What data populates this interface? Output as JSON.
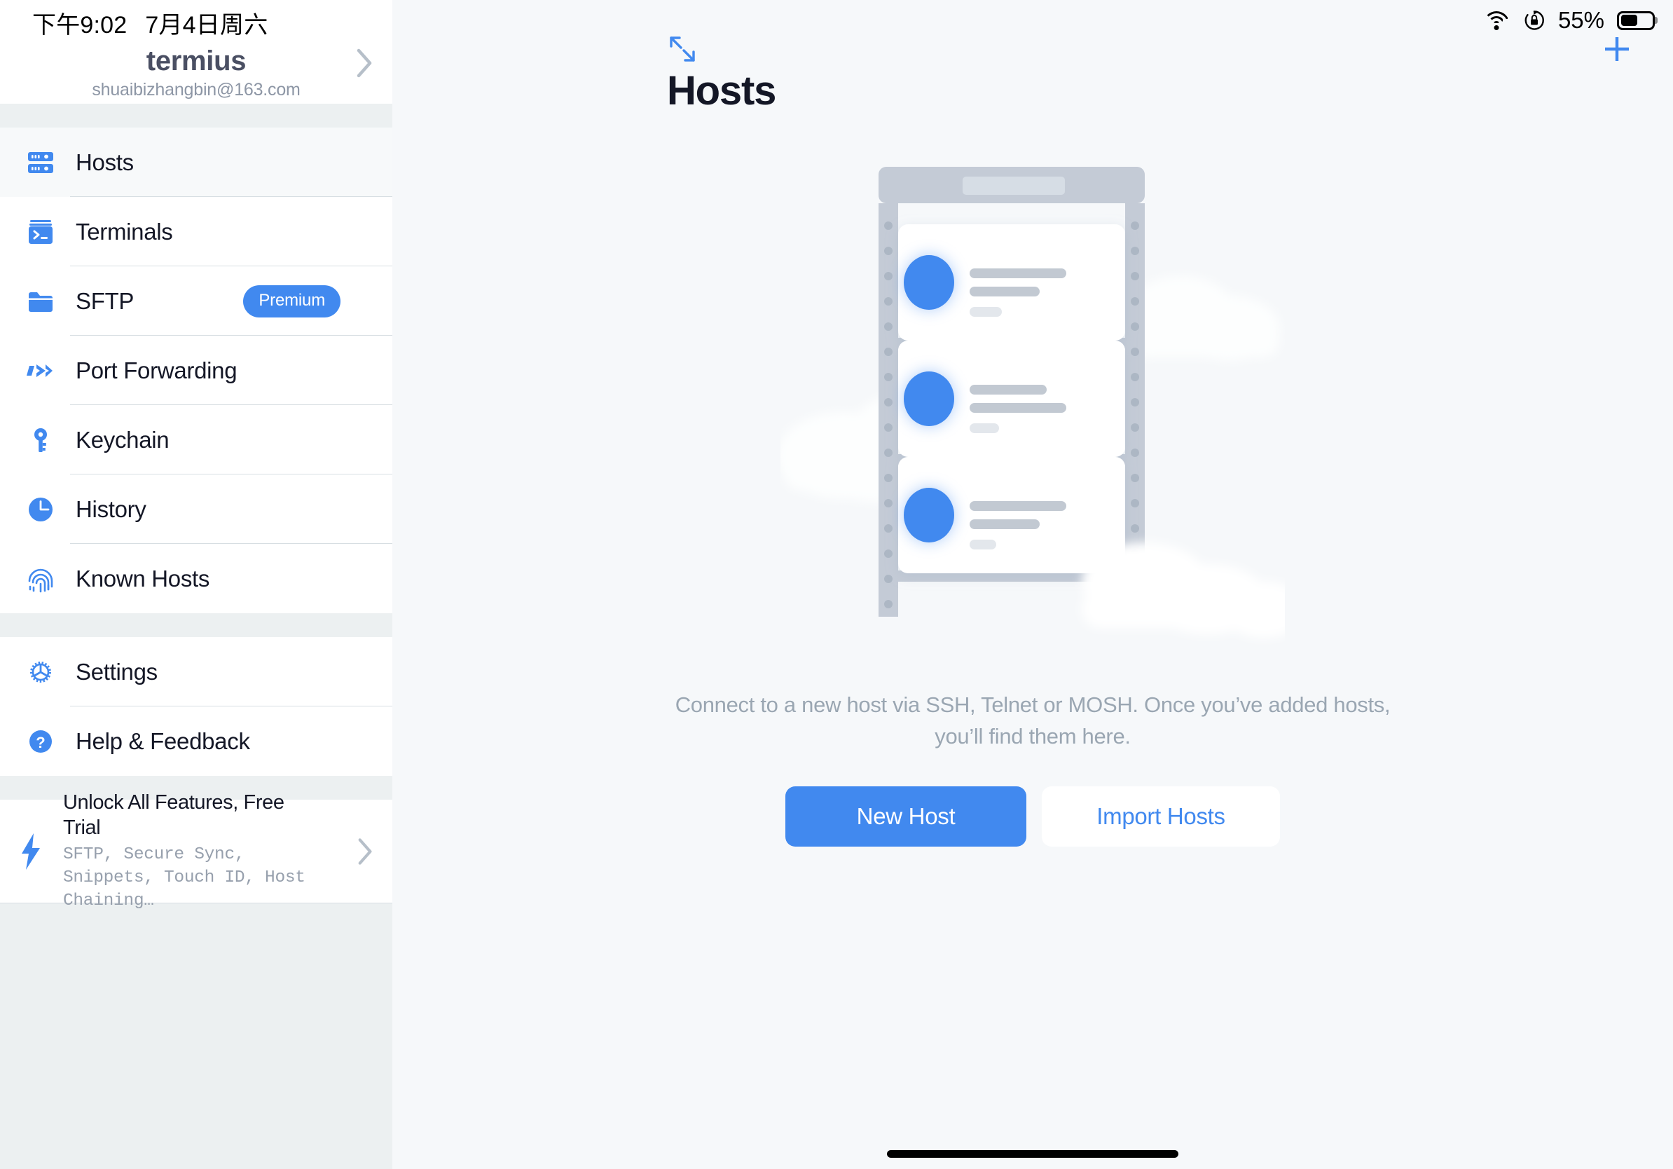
{
  "status_bar": {
    "time": "下午9:02",
    "date": "7月4日周六",
    "battery_percent": "55%",
    "battery_level": 55,
    "icons": [
      "wifi-icon",
      "rotation-lock-icon",
      "battery-icon"
    ]
  },
  "sidebar": {
    "account": {
      "name": "termius",
      "email": "shuaibizhangbin@163.com",
      "chevron": "chevron-right-icon"
    },
    "groups": [
      {
        "items": [
          {
            "label": "Hosts",
            "icon": "server-rack-icon",
            "active": true,
            "badge": ""
          },
          {
            "label": "Terminals",
            "icon": "terminal-icon",
            "active": false,
            "badge": ""
          },
          {
            "label": "SFTP",
            "icon": "folder-icon",
            "active": false,
            "badge": "Premium"
          },
          {
            "label": "Port Forwarding",
            "icon": "arrow-forward-icon",
            "active": false,
            "badge": ""
          },
          {
            "label": "Keychain",
            "icon": "key-icon",
            "active": false,
            "badge": ""
          },
          {
            "label": "History",
            "icon": "clock-icon",
            "active": false,
            "badge": ""
          },
          {
            "label": "Known Hosts",
            "icon": "fingerprint-icon",
            "active": false,
            "badge": ""
          }
        ]
      },
      {
        "items": [
          {
            "label": "Settings",
            "icon": "gear-icon",
            "active": false,
            "badge": ""
          },
          {
            "label": "Help & Feedback",
            "icon": "question-mark-icon",
            "active": false,
            "badge": ""
          }
        ]
      }
    ],
    "promo": {
      "icon": "lightning-bolt-icon",
      "title": "Unlock All Features, Free Trial",
      "subtitle": "SFTP, Secure Sync, Snippets, Touch ID, Host Chaining…",
      "chevron": "chevron-right-icon"
    }
  },
  "main": {
    "expand_icon": "expand-arrows-icon",
    "add_icon": "plus-icon",
    "title": "Hosts",
    "illustration": "server-rack-with-clouds-illustration",
    "empty_state": {
      "description": "Connect to a new host via SSH, Telnet or MOSH. Once you’ve added hosts, you’ll find them here.",
      "primary_button": "New Host",
      "secondary_button": "Import Hosts"
    }
  },
  "colors": {
    "accent_blue": "#4189EF",
    "sidebar_bg": "#ECF0F1",
    "panel_bg": "#F6F8FA",
    "text_dark": "#141726",
    "text_muted": "#9AA6B2"
  }
}
